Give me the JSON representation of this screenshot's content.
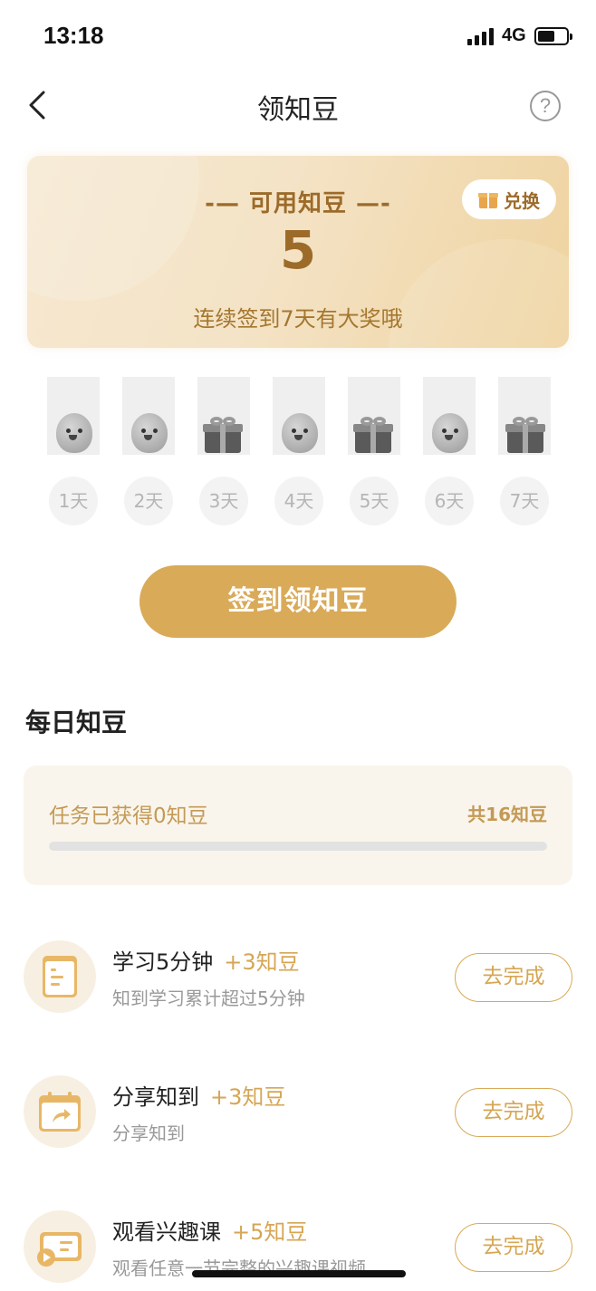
{
  "status_bar": {
    "time": "13:18",
    "network": "4G"
  },
  "header": {
    "title": "领知豆",
    "help_symbol": "?"
  },
  "points_card": {
    "label": "-— 可用知豆 —-",
    "value": "5",
    "hint": "连续签到7天有大奖哦",
    "exchange_label": "兑换"
  },
  "checkin_days": [
    {
      "label": "1天",
      "reward_icon": "bean-icon"
    },
    {
      "label": "2天",
      "reward_icon": "bean-icon"
    },
    {
      "label": "3天",
      "reward_icon": "gift-icon"
    },
    {
      "label": "4天",
      "reward_icon": "bean-icon"
    },
    {
      "label": "5天",
      "reward_icon": "gift-icon"
    },
    {
      "label": "6天",
      "reward_icon": "bean-icon"
    },
    {
      "label": "7天",
      "reward_icon": "big-gift-icon"
    }
  ],
  "signin_button": "签到领知豆",
  "daily": {
    "title": "每日知豆",
    "earned_text": "任务已获得0知豆",
    "total_text": "共16知豆",
    "progress_fraction": 0
  },
  "tasks": [
    {
      "title": "学习5分钟",
      "reward": "+3知豆",
      "desc": "知到学习累计超过5分钟",
      "button": "去完成",
      "icon": "document-icon"
    },
    {
      "title": "分享知到",
      "reward": "+3知豆",
      "desc": "分享知到",
      "button": "去完成",
      "icon": "share-calendar-icon"
    },
    {
      "title": "观看兴趣课",
      "reward": "+5知豆",
      "desc": "观看任意一节完整的兴趣课视频",
      "button": "去完成",
      "icon": "video-course-icon"
    }
  ],
  "colors": {
    "accent": "#d9aa58",
    "accent_text": "#9c6b2a",
    "card_bg": "#faf5ec"
  }
}
